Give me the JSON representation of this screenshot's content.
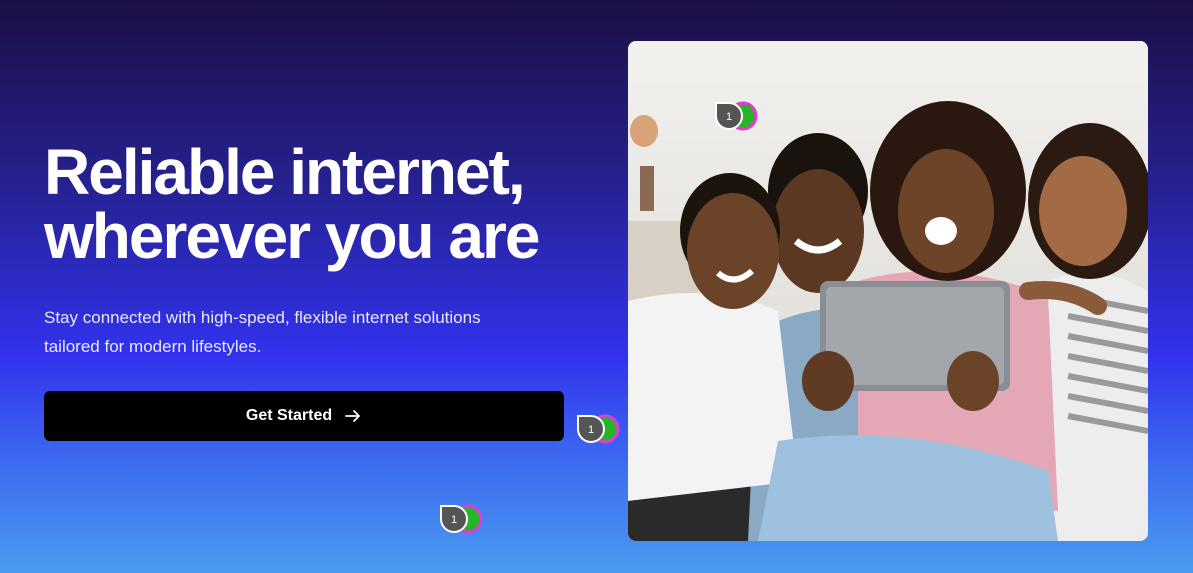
{
  "hero": {
    "title": "Reliable internet,\nwherever you are",
    "subtitle": "Stay connected with high-speed, flexible internet solutions tailored for modern lifestyles.",
    "cta_label": "Get Started",
    "cta_icon": "arrow-right-icon"
  },
  "photo": {
    "subject": "family-with-tablet"
  },
  "markers": [
    {
      "label": "1"
    },
    {
      "label": "1"
    },
    {
      "label": "1"
    }
  ],
  "colors": {
    "cta_background": "#000000",
    "text": "#ffffff",
    "gradient_top": "#1c0f45",
    "gradient_mid": "#3232ee",
    "gradient_bottom": "#4a9af0"
  }
}
